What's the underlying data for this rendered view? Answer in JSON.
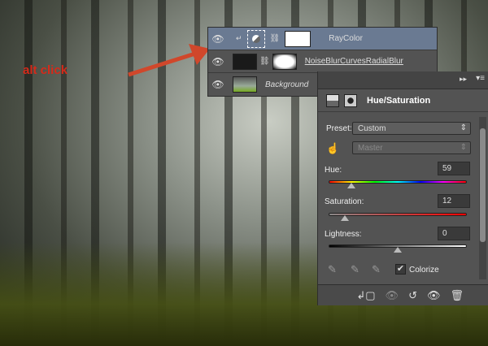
{
  "annotation": {
    "text": "alt click",
    "color": "#d52a1a"
  },
  "layers": [
    {
      "name": "RayColor",
      "selected": true
    },
    {
      "name": "NoiseBlurCurvesRadialBlur",
      "selected": false
    },
    {
      "name": "Background",
      "selected": false,
      "locked": true
    }
  ],
  "properties": {
    "title": "Hue/Saturation",
    "preset_label": "Preset:",
    "preset_value": "Custom",
    "channel_value": "Master",
    "hue_label": "Hue:",
    "hue_value": "59",
    "saturation_label": "Saturation:",
    "saturation_value": "12",
    "lightness_label": "Lightness:",
    "lightness_value": "0",
    "colorize_label": "Colorize",
    "colorize_checked": true
  }
}
